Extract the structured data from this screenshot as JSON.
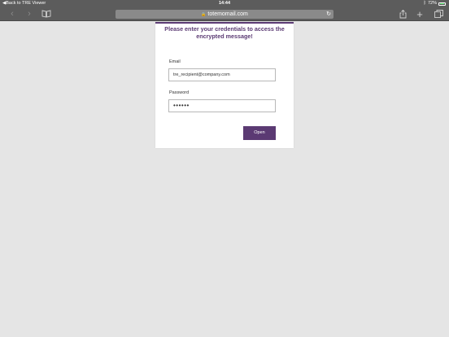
{
  "status_bar": {
    "back_label": "Back to TRE Viewer",
    "time": "14:44",
    "battery": "72%",
    "battery_level": 0.72
  },
  "browser": {
    "url": "totemomail.com",
    "icons": {
      "back": "chevron-left-icon",
      "forward": "chevron-right-icon",
      "bookmarks": "book-icon",
      "reload": "reload-icon",
      "share": "share-icon",
      "new_tab": "plus-icon",
      "tabs": "tabs-icon"
    }
  },
  "login": {
    "heading": "Please enter your credentials to access the encrypted message!",
    "email_label": "Email",
    "email_value": "tre_recipient@company.com",
    "password_label": "Password",
    "password_value": "••••••",
    "open_label": "Open"
  },
  "colors": {
    "accent": "#5b3a73",
    "chrome": "#5c5c5c",
    "background": "#e5e5e5"
  }
}
